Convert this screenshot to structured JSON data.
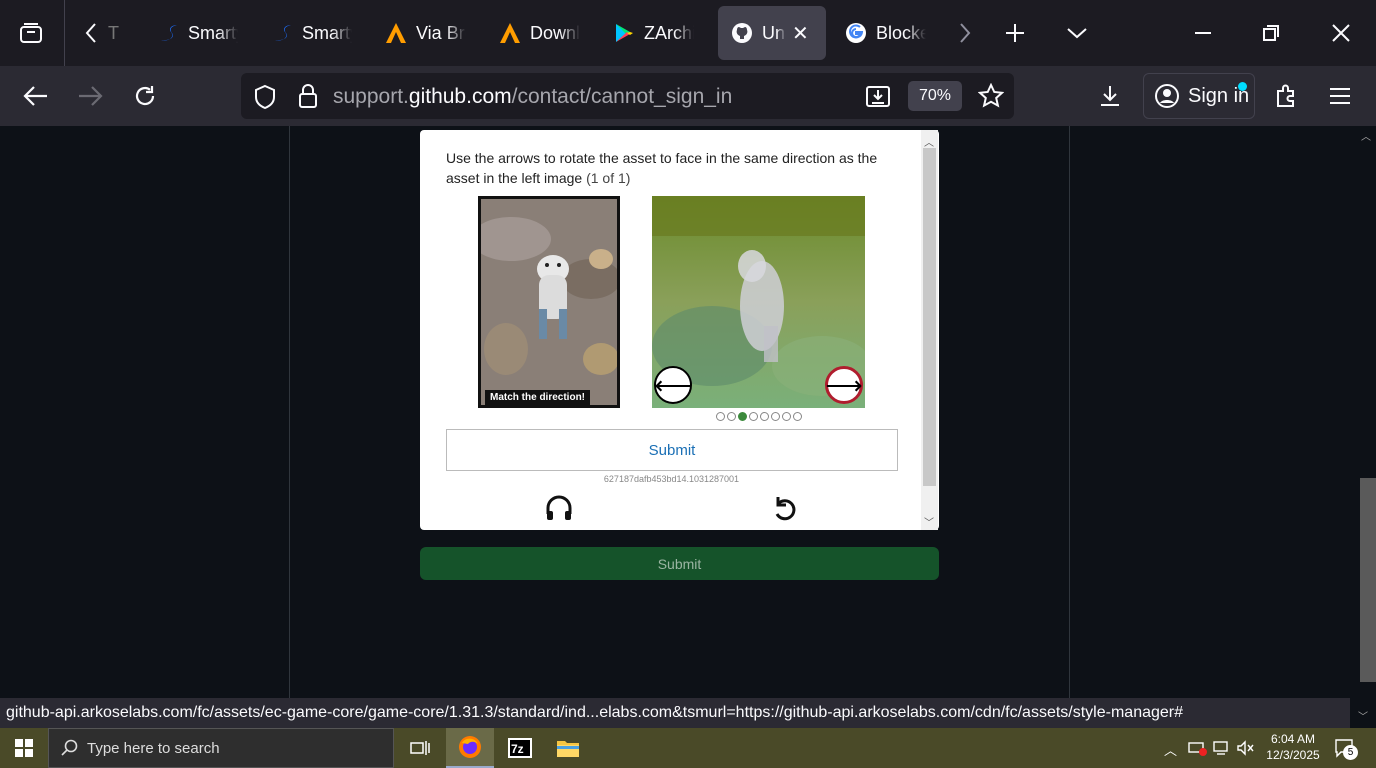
{
  "browser": {
    "tabs": [
      {
        "title": "T",
        "icon": "tab-icon",
        "active": false
      },
      {
        "title": "Smarty",
        "icon": "smart-swan-icon",
        "active": false
      },
      {
        "title": "Smarty",
        "icon": "smart-swan-icon",
        "active": false
      },
      {
        "title": "Via Browser",
        "icon": "via-a-icon",
        "active": false
      },
      {
        "title": "Download",
        "icon": "via-a-icon",
        "active": false
      },
      {
        "title": "ZArchiver",
        "icon": "play-store-icon",
        "active": false
      },
      {
        "title": "Unable",
        "icon": "github-icon",
        "active": true
      },
      {
        "title": "Blocked",
        "icon": "google-icon",
        "active": false
      }
    ],
    "url_host_prefix": "support.",
    "url_host_main": "github.com",
    "url_path": "/contact/cannot_sign_in",
    "zoom": "70%",
    "sign_in_label": "Sign in",
    "status_url": "github-api.arkoselabs.com/fc/assets/ec-game-core/game-core/1.31.3/standard/ind...elabs.com&tsmurl=https://github-api.arkoselabs.com/cdn/fc/assets/style-manager#"
  },
  "captcha": {
    "instruction": "Use the arrows to rotate the asset to face in the same direction as the asset in the left image",
    "counter": "(1 of 1)",
    "reference_caption": "Match the direction!",
    "submit_label": "Submit",
    "session_id": "627187dafb453bd14.1031287001",
    "dots_total": 8,
    "dots_active_index": 2,
    "audio_label": "Audio",
    "restart_label": "Restart"
  },
  "page": {
    "submit_label": "Submit"
  },
  "taskbar": {
    "search_placeholder": "Type here to search",
    "time": "6:04 AM",
    "date": "12/3/2025",
    "notification_count": "5"
  },
  "colors": {
    "tabstrip": "#1c1b22",
    "navbar": "#2b2a33",
    "page_bg": "#0d1117",
    "submit_green": "#15532a"
  }
}
